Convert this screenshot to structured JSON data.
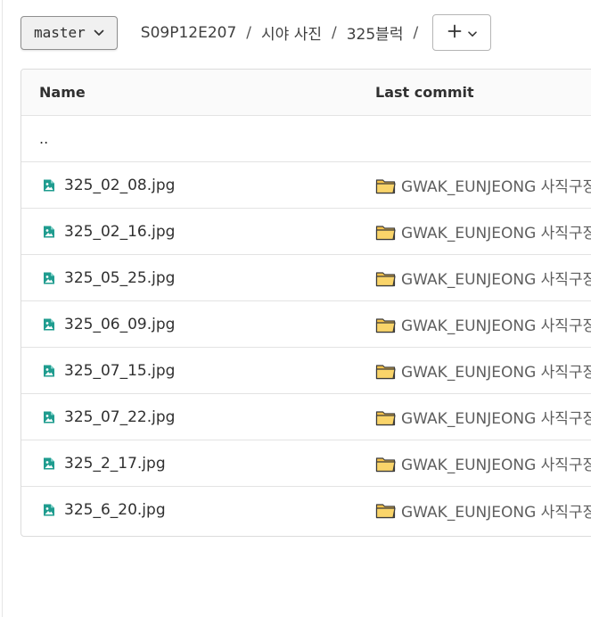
{
  "branch": {
    "label": "master"
  },
  "breadcrumb": {
    "items": [
      "S09P12E207",
      "시야 사진",
      "325블럭"
    ],
    "separator": "/"
  },
  "table": {
    "headers": {
      "name": "Name",
      "last_commit": "Last commit"
    },
    "parent_dir": "..",
    "rows": [
      {
        "name": "325_02_08.jpg",
        "commit": "GWAK_EUNJEONG 사직구장"
      },
      {
        "name": "325_02_16.jpg",
        "commit": "GWAK_EUNJEONG 사직구장"
      },
      {
        "name": "325_05_25.jpg",
        "commit": "GWAK_EUNJEONG 사직구장"
      },
      {
        "name": "325_06_09.jpg",
        "commit": "GWAK_EUNJEONG 사직구장"
      },
      {
        "name": "325_07_15.jpg",
        "commit": "GWAK_EUNJEONG 사직구장"
      },
      {
        "name": "325_07_22.jpg",
        "commit": "GWAK_EUNJEONG 사직구장"
      },
      {
        "name": "325_2_17.jpg",
        "commit": "GWAK_EUNJEONG 사직구장"
      },
      {
        "name": "325_6_20.jpg",
        "commit": "GWAK_EUNJEONG 사직구장"
      }
    ]
  },
  "icons": {
    "file": "image-file-icon",
    "commit": "folder-emoji-icon",
    "add": "plus-icon",
    "dropdown": "chevron-down-icon"
  },
  "colors": {
    "file_icon": "#1f9c8f",
    "folder": "#f5c24a"
  }
}
